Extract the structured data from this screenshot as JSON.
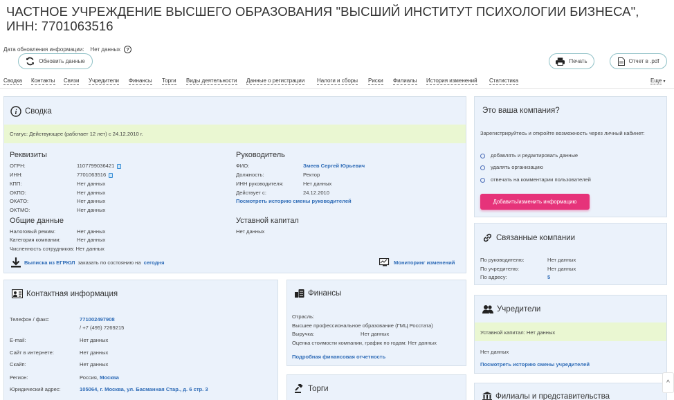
{
  "page": {
    "title": "ЧАСТНОЕ УЧРЕЖДЕНИЕ ВЫСШЕГО ОБРАЗОВАНИЯ \"ВЫСШИЙ ИНСТИТУТ ПСИХОЛОГИИ БИЗНЕСА\", ИНН: 7701063516",
    "update_label": "Дата обновления информации:",
    "update_value": "Нет данных"
  },
  "toolbar": {
    "refresh_label": "Обновить данные",
    "print_label": "Печать",
    "pdf_label": "Отчет в .pdf"
  },
  "tabs": [
    "Сводка",
    "Контакты",
    "Связи",
    "Учредители",
    "Финансы",
    "Торги",
    "Виды деятельности",
    "Данные о регистрации",
    "Налоги и сборы",
    "Риски",
    "Филиалы",
    "История изменений",
    "Статистика"
  ],
  "tabs_more": "Еще",
  "summary": {
    "title": "Сводка",
    "status": "Статус: Действующее (работает 12 лет) с 24.12.2010 г.",
    "requisites_title": "Реквизиты",
    "requisites": [
      {
        "label": "ОГРН:",
        "value": "1107799036421"
      },
      {
        "label": "ИНН:",
        "value": "7701063516"
      },
      {
        "label": "КПП:",
        "value": "Нет данных"
      },
      {
        "label": "ОКПО:",
        "value": "Нет данных"
      },
      {
        "label": "ОКАТО:",
        "value": "Нет данных"
      },
      {
        "label": "ОКТМО:",
        "value": "Нет данных"
      }
    ],
    "general_title": "Общие данные",
    "general": [
      {
        "label": "Налоговый режим:",
        "value": "Нет данных"
      },
      {
        "label": "Категория компании:",
        "value": "Нет данных"
      }
    ],
    "employees": "Численность сотрудников: Нет данных",
    "head_title": "Руководитель",
    "head": [
      {
        "label": "ФИО:",
        "value": "Змеев Сергей Юрьевич"
      },
      {
        "label": "Должность:",
        "value": "Ректор"
      },
      {
        "label": "ИНН руководителя:",
        "value": "Нет данных"
      },
      {
        "label": "Действует с:",
        "value": "24.12.2010"
      }
    ],
    "head_history_link": "Посмотреть историю смены руководителей",
    "capital_title": "Уставной капитал",
    "capital_value": "Нет данных",
    "egrul_link": "Выписка из ЕГРЮЛ",
    "egrul_text": "заказать по состоянию на",
    "egrul_today": "сегодня",
    "monitoring_link": "Мониторинг изменений"
  },
  "your_company": {
    "title": "Это ваша компания?",
    "text": "Зарегистрируйтесь и откройте возможность через личный кабинет:",
    "items": [
      "добавлять и редактировать данные",
      "удалять организацию",
      "отвечать на комментарии пользователей"
    ],
    "button": "Добавить/изменить информацию"
  },
  "related": {
    "title": "Связанные компании",
    "rows": [
      {
        "label": "По руководителю:",
        "value": "Нет данных"
      },
      {
        "label": "По учредителю:",
        "value": "Нет данных"
      },
      {
        "label": "По адресу:",
        "value": "5"
      }
    ]
  },
  "founders": {
    "title": "Учредители",
    "capital": "Уставной капитал: Нет данных",
    "none": "Нет данных",
    "history_link": "Посмотреть историю смены учредителей"
  },
  "branches": {
    "title": "Филиалы и представительства"
  },
  "contacts": {
    "title": "Контактная информация",
    "phone_label": "Телефон / факс:",
    "phone_link": "771002497908",
    "phone2": "/ +7 (495) 7269215",
    "rows": [
      {
        "label": "E-mail:",
        "value": "Нет данных"
      },
      {
        "label": "Сайт в интернете:",
        "value": "Нет данных"
      },
      {
        "label": "Скайп:",
        "value": "Нет данных"
      }
    ],
    "region_label": "Регион:",
    "region_value": "Россия,",
    "region_link": "Москва",
    "address_label": "Юридический адрес:",
    "address_link": "105064, г. Москва, ул. Басманная Стар., д. 6 стр. 3"
  },
  "finance": {
    "title": "Финансы",
    "industry_label": "Отрасль:",
    "industry_value": "Высшее профессиональное образование (ГМЦ Росстата)",
    "revenue_label": "Выручка:",
    "revenue_value": "Нет данных",
    "estimate": "Оценка стоимости компании, график по годам: Нет данных",
    "report_link": "Подробная финансовая отчетность"
  },
  "trades": {
    "title": "Торги"
  },
  "colors": {
    "accent": "#2f6cb7",
    "button": "#e6337a",
    "status_bg": "#eaf7d2",
    "card_bg": "#ebf2fb"
  }
}
